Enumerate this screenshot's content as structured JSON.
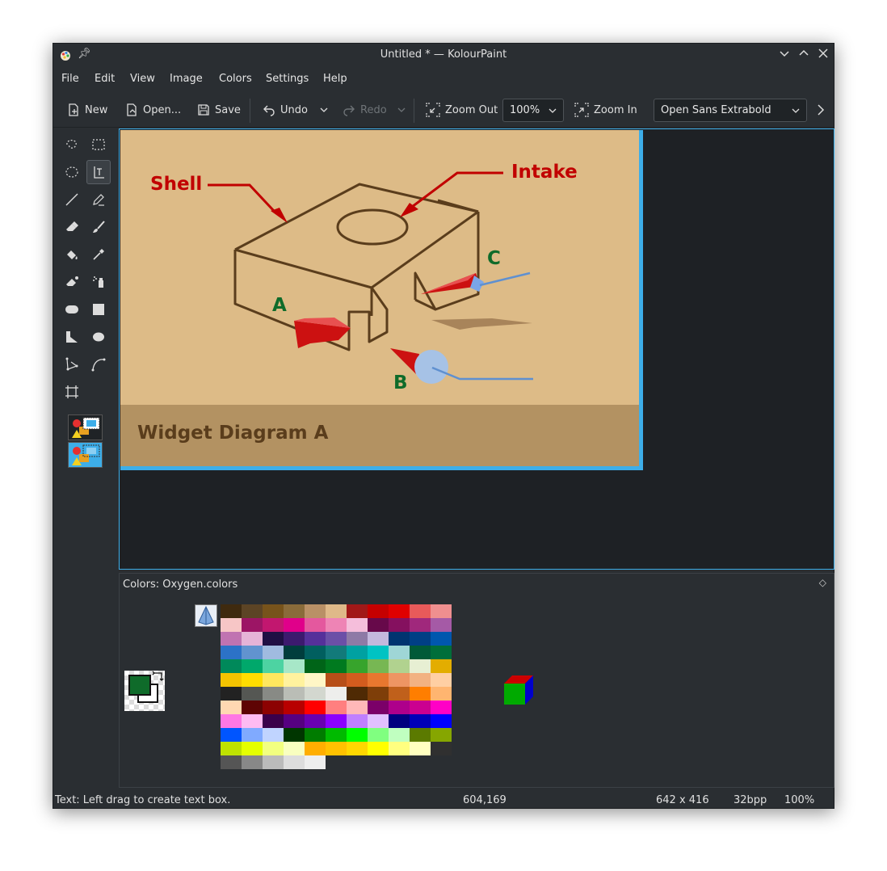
{
  "window": {
    "title": "Untitled * — KolourPaint",
    "controls": [
      "minimize-icon",
      "maximize-icon",
      "close-icon"
    ]
  },
  "menu": [
    "File",
    "Edit",
    "View",
    "Image",
    "Colors",
    "Settings",
    "Help"
  ],
  "toolbar": {
    "new": "New",
    "open": "Open...",
    "save": "Save",
    "undo": "Undo",
    "redo": "Redo",
    "zoom_out": "Zoom Out",
    "zoom_level": "100%",
    "zoom_in": "Zoom In",
    "font": "Open Sans Extrabold"
  },
  "tools": [
    "free-form-selection-icon",
    "rectangle-selection-icon",
    "ellipse-selection-icon",
    "text-icon",
    "line-icon",
    "pen-icon",
    "eraser-icon",
    "brush-icon",
    "flood-fill-icon",
    "color-picker-icon",
    "color-eraser-icon",
    "spraycan-icon",
    "rounded-rectangle-icon",
    "rectangle-icon",
    "polygon-icon",
    "ellipse-icon",
    "polyline-icon",
    "curve-icon",
    "resize-icon"
  ],
  "canvas_image": {
    "labels": {
      "shell": "Shell",
      "intake": "Intake",
      "a": "A",
      "b": "B",
      "c": "C"
    },
    "caption": "Widget Diagram A"
  },
  "colors_panel": {
    "title": "Colors: Oxygen.colors",
    "foreground": "#0f6b2a",
    "background": "#ffffff",
    "palette": [
      "#3f2a0f",
      "#5c4425",
      "#77531b",
      "#8a6b3a",
      "#b99066",
      "#dfb989",
      "#a11818",
      "#c60000",
      "#e00000",
      "#e85a5a",
      "#ef8f8f",
      "#f7c6c6",
      "#9c1565",
      "#c2176f",
      "#e0008a",
      "#e4589e",
      "#ee84b5",
      "#f5bedb",
      "#67094a",
      "#85105f",
      "#a0287c",
      "#a55aa6",
      "#c073b1",
      "#e6b3d7",
      "#200f44",
      "#3c1a6e",
      "#55309a",
      "#6b4fa7",
      "#8e7aa6",
      "#c4b8dd",
      "#003470",
      "#003f85",
      "#0057ae",
      "#2c72c7",
      "#6193cf",
      "#a0bbe0",
      "#003d3d",
      "#015f5f",
      "#127a7a",
      "#00a1a1",
      "#00c3c3",
      "#9fd6d6",
      "#005a38",
      "#006e3a",
      "#00895a",
      "#00a86b",
      "#4dd3a2",
      "#a7e7c8",
      "#006418",
      "#007a1f",
      "#37a42c",
      "#77b753",
      "#b1d28f",
      "#e7efd3",
      "#e3ad00",
      "#f3c300",
      "#ffdd00",
      "#ffe75e",
      "#fff29e",
      "#fff6c6",
      "#b74e18",
      "#d35c1e",
      "#e8772f",
      "#ee9563",
      "#f2b282",
      "#ffcfa3",
      "#222222",
      "#555753",
      "#888a85",
      "#babdb6",
      "#d3d7cf",
      "#eeeeec",
      "#4f2a04",
      "#7e3e09",
      "#c0601b",
      "#ff7e00",
      "#ffb570",
      "#ffd8b2",
      "#5e0404",
      "#8c0202",
      "#b80000",
      "#ff0000",
      "#ff7f7f",
      "#ffb8b8",
      "#7b0068",
      "#ae008b",
      "#cb0090",
      "#ff00c6",
      "#ff77e4",
      "#ffbbf2",
      "#3a004b",
      "#560081",
      "#6a00b0",
      "#8b00ff",
      "#c080ff",
      "#e1c0ff",
      "#00007f",
      "#0000b8",
      "#0000ff",
      "#0055ff",
      "#80aaff",
      "#c0d4ff",
      "#003600",
      "#007c00",
      "#00ba00",
      "#00ff00",
      "#80ff80",
      "#c0ffc0",
      "#5b7a00",
      "#86a600",
      "#bfe200",
      "#e5ff00",
      "#f2ff80",
      "#f9ffc0",
      "#ffae00",
      "#ffc100",
      "#ffd700",
      "#ffff00",
      "#ffff80",
      "#ffffc0",
      "#303030",
      "#555555",
      "#888888",
      "#bbbbbb",
      "#dddddd",
      "#eeeeee"
    ]
  },
  "status": {
    "message": "Text: Left drag to create text box.",
    "cursor": "604,169",
    "size": "642 x 416",
    "depth": "32bpp",
    "zoom": "100%"
  }
}
